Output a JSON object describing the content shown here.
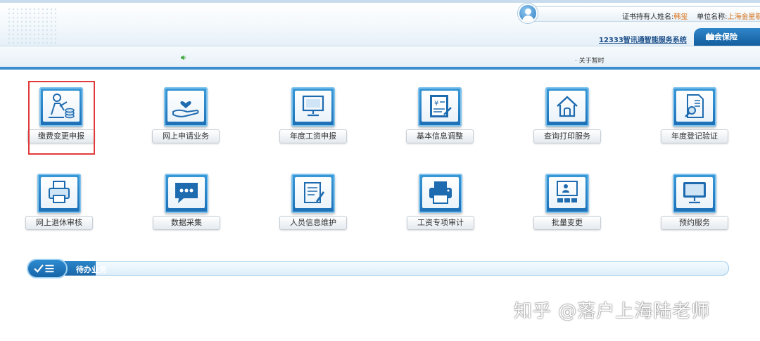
{
  "header": {
    "user_prefix": "证书持有人姓名:",
    "user_name": "韩玺",
    "unit_prefix": "单位名称:",
    "unit_name": "上海金星职",
    "system_link": "12333智讯通智能服务系统",
    "tab_label": "社会保险"
  },
  "notice": {
    "text": "· 关于暂时"
  },
  "tiles_row1": [
    {
      "label": "缴费变更申报",
      "icon": "person-coins-icon"
    },
    {
      "label": "网上申请业务",
      "icon": "hand-heart-icon"
    },
    {
      "label": "年度工资申报",
      "icon": "monitor-icon"
    },
    {
      "label": "基本信息调整",
      "icon": "yen-document-icon"
    },
    {
      "label": "查询打印服务",
      "icon": "house-icon"
    },
    {
      "label": "年度登记验证",
      "icon": "document-search-icon"
    }
  ],
  "tiles_row2": [
    {
      "label": "网上退休审核",
      "icon": "printer-icon"
    },
    {
      "label": "数据采集",
      "icon": "chat-bubble-icon"
    },
    {
      "label": "人员信息维护",
      "icon": "document-edit-icon"
    },
    {
      "label": "工资专项审计",
      "icon": "printer-icon"
    },
    {
      "label": "批量变更",
      "icon": "presentation-icon"
    },
    {
      "label": "预约服务",
      "icon": "monitor-icon"
    }
  ],
  "pending": {
    "title": "待办业务"
  },
  "watermark": "知乎 @落户上海陆老师",
  "colors": {
    "accent": "#2f86c9",
    "highlight": "#e03a3a",
    "unit_name": "#d9731a"
  }
}
